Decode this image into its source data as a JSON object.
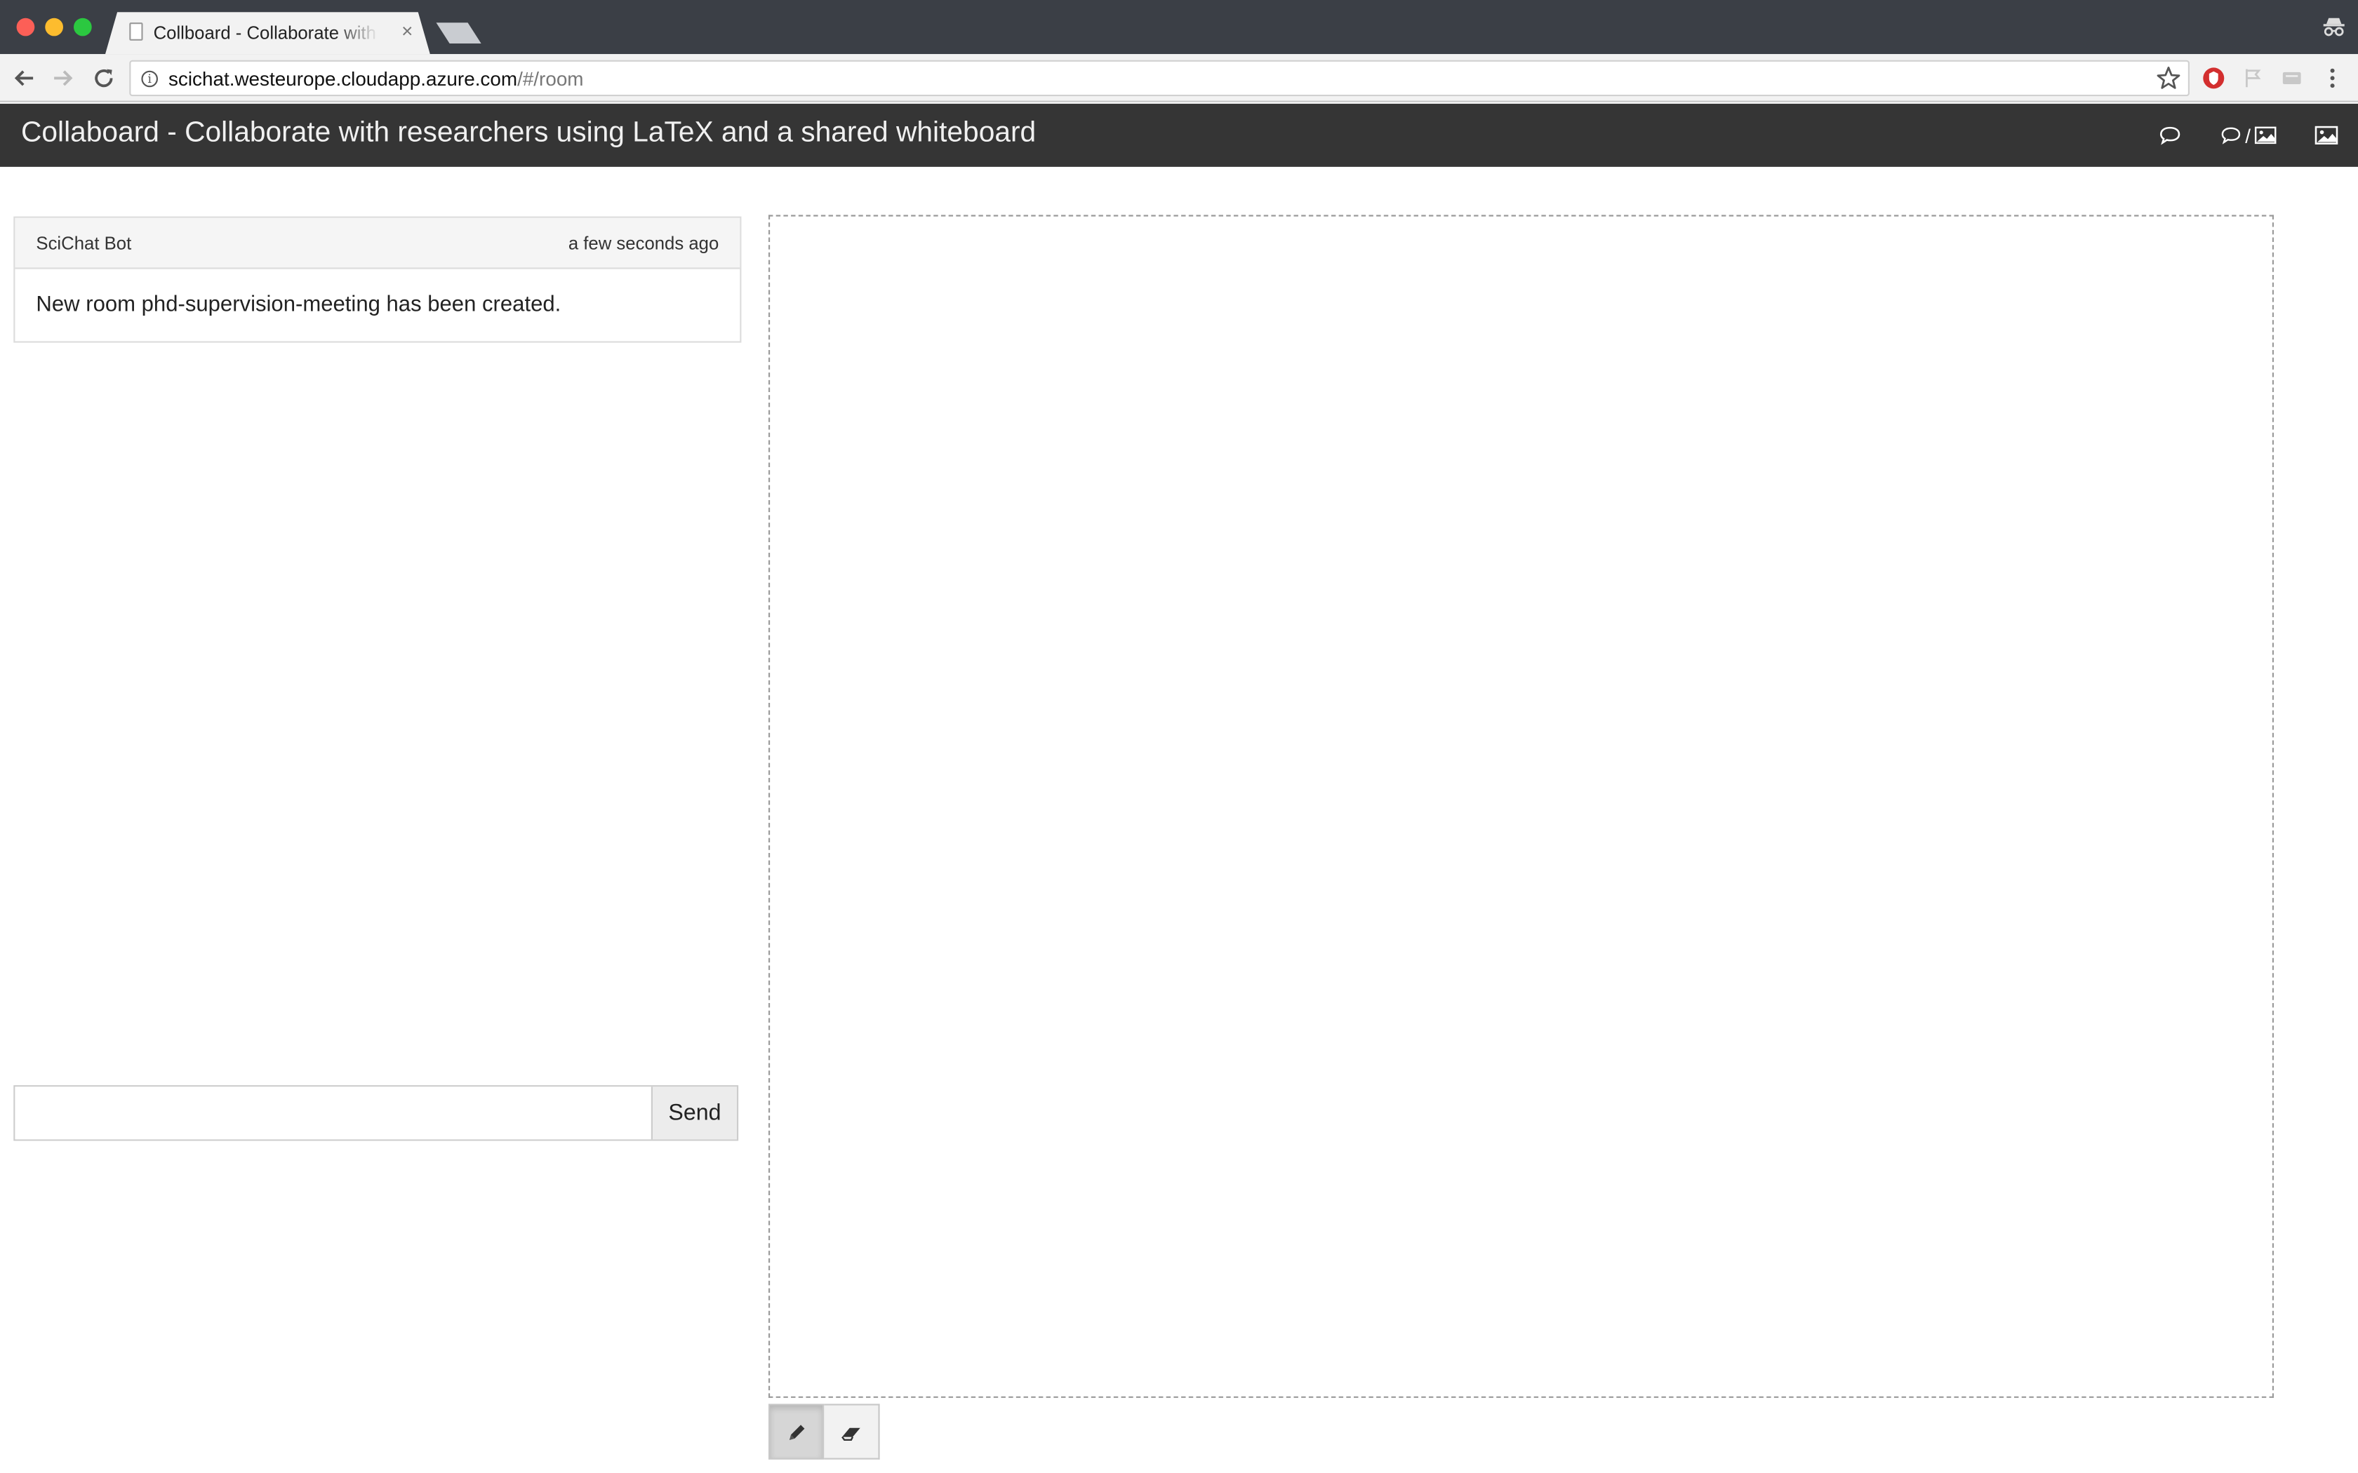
{
  "browser": {
    "tab_title": "Collboard - Collaborate with re",
    "tab_close": "×",
    "url_host": "scichat.westeurope.cloudapp.azure.com",
    "url_path": "/#/room",
    "info_glyph": "i"
  },
  "app": {
    "title": "Collaboard - Collaborate with researchers using LaTeX and a shared whiteboard",
    "view_toggle_separator": "/"
  },
  "chat": {
    "messages": [
      {
        "author": "SciChat Bot",
        "time": "a few seconds ago",
        "text": "New room phd-supervision-meeting has been created."
      }
    ],
    "input_value": "",
    "input_placeholder": "",
    "send_label": "Send"
  },
  "whiteboard": {
    "tools": [
      {
        "name": "pencil",
        "icon": "pencil-icon",
        "active": true
      },
      {
        "name": "eraser",
        "icon": "eraser-icon",
        "active": false
      }
    ]
  },
  "colors": {
    "navbar_bg": "#353535",
    "tabstrip_bg": "#3b3f46",
    "toolbar_bg": "#f2f2f2"
  }
}
